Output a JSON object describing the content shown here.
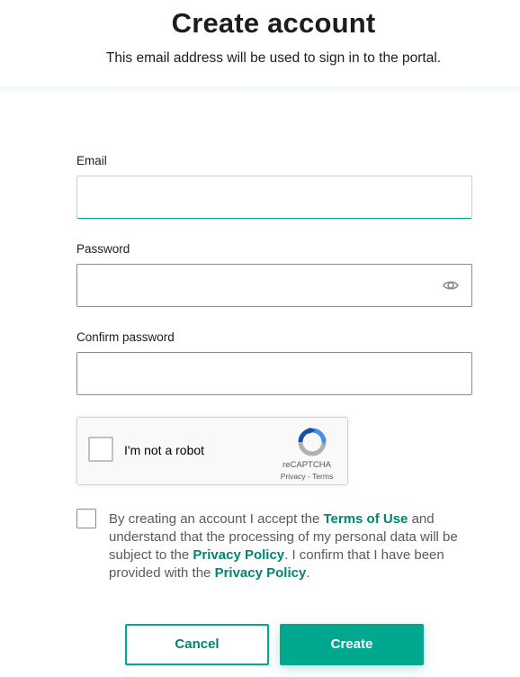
{
  "header": {
    "title": "Create account",
    "subtitle": "This email address will be used to sign in to the portal."
  },
  "form": {
    "email": {
      "label": "Email",
      "value": "",
      "placeholder": ""
    },
    "password": {
      "label": "Password",
      "value": "",
      "placeholder": "",
      "toggle_icon": "eye-icon"
    },
    "confirm_password": {
      "label": "Confirm password",
      "value": "",
      "placeholder": ""
    }
  },
  "recaptcha": {
    "label": "I'm not a robot",
    "brand": "reCAPTCHA",
    "privacy": "Privacy",
    "separator": "-",
    "terms": "Terms",
    "checked": false
  },
  "agreement": {
    "checked": false,
    "text_1": "By creating an account I accept the ",
    "link_terms": "Terms of Use",
    "text_2": " and understand that the processing of my personal data will be subject to the ",
    "link_privacy_1": "Privacy Policy",
    "text_3": ". I confirm that I have been provided with the ",
    "link_privacy_2": "Privacy Policy",
    "text_4": "."
  },
  "actions": {
    "cancel_label": "Cancel",
    "create_label": "Create"
  },
  "colors": {
    "accent": "#00a88e",
    "link": "#00856f",
    "text": "#1d1d1b"
  }
}
